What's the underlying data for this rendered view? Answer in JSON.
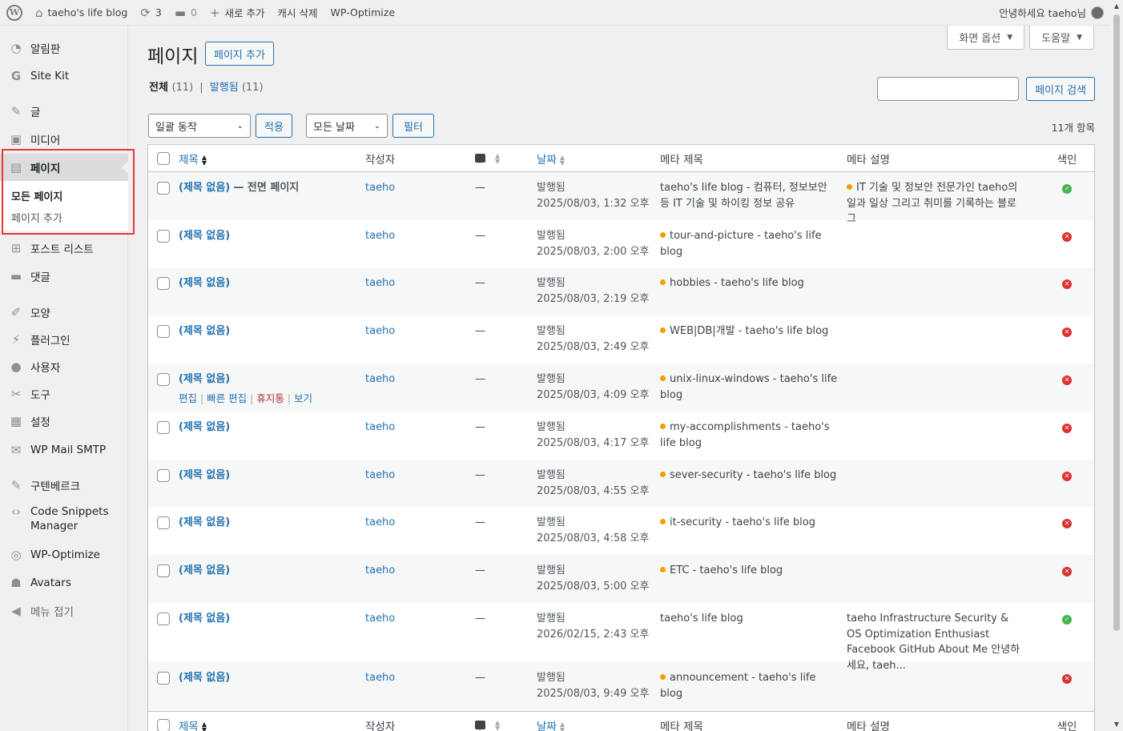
{
  "adminbar": {
    "site_name": "taeho's life blog",
    "updates_count": "3",
    "comments_count": "0",
    "new_label": "새로 추가",
    "cache_label": "캐시 삭제",
    "optimize_label": "WP-Optimize",
    "greeting": "안녕하세요 taeho님"
  },
  "sidebar": {
    "items": [
      {
        "label": "알림판",
        "icon": "dashboard-icon",
        "glyph": "◔"
      },
      {
        "label": "Site Kit",
        "icon": "google-icon",
        "glyph": "G"
      },
      {
        "label": "글",
        "icon": "pin-icon",
        "glyph": "✎"
      },
      {
        "label": "미디어",
        "icon": "media-icon",
        "glyph": "▣"
      },
      {
        "label": "페이지",
        "icon": "page-icon",
        "glyph": "▤"
      },
      {
        "label": "포스트 리스트",
        "icon": "grid-icon",
        "glyph": "⊞"
      },
      {
        "label": "댓글",
        "icon": "comment-icon",
        "glyph": "▬"
      },
      {
        "label": "모양",
        "icon": "brush-icon",
        "glyph": "✐"
      },
      {
        "label": "플러그인",
        "icon": "plugin-icon",
        "glyph": "⚡"
      },
      {
        "label": "사용자",
        "icon": "user-icon",
        "glyph": "●"
      },
      {
        "label": "도구",
        "icon": "wrench-icon",
        "glyph": "✂"
      },
      {
        "label": "설정",
        "icon": "settings-icon",
        "glyph": "▦"
      },
      {
        "label": "WP Mail SMTP",
        "icon": "mail-icon",
        "glyph": "✉"
      },
      {
        "label": "구텐베르크",
        "icon": "gutenberg-icon",
        "glyph": "✎"
      },
      {
        "label": "Code Snippets",
        "label2": "Manager",
        "icon": "code-icon",
        "glyph": "‹›"
      },
      {
        "label": "WP-Optimize",
        "icon": "optimize-icon",
        "glyph": "◎"
      },
      {
        "label": "Avatars",
        "icon": "avatars-icon",
        "glyph": "☗"
      },
      {
        "label": "메뉴 접기",
        "icon": "collapse-icon",
        "glyph": "◀"
      }
    ],
    "submenu": {
      "all_pages": "모든 페이지",
      "add_page": "페이지 추가"
    }
  },
  "header": {
    "title": "페이지",
    "add_new": "페이지 추가",
    "screen_options": "화면 옵션",
    "help": "도움말"
  },
  "views": {
    "all_label": "전체",
    "all_count": "(11)",
    "separator": "|",
    "published_label": "발행됨",
    "published_count": "(11)"
  },
  "search": {
    "button": "페이지 검색"
  },
  "tablenav": {
    "bulk_action": "일괄 동작",
    "apply": "적용",
    "all_dates": "모든 날짜",
    "filter": "필터",
    "item_count": "11개 항목"
  },
  "columns": {
    "title": "제목",
    "author": "작성자",
    "date": "날짜",
    "meta_title": "메타 제목",
    "meta_desc": "메타 설명",
    "index": "색인"
  },
  "rows": [
    {
      "title": "(제목 없음)",
      "state": "— 전면 페이지",
      "author": "taeho",
      "comments": "—",
      "status": "발행됨",
      "date": "2025/08/03, 1:32 오후",
      "meta_title": "taeho's life blog - 컴퓨터, 정보보안 등 IT 기술 및 하이킹 정보 공유",
      "meta_title_dot": false,
      "meta_desc": "IT 기술 및 정보안 전문가인 taeho의 일과 일상 그리고 취미를 기록하는 블로그",
      "meta_desc_dot": true,
      "indexed": "ok"
    },
    {
      "title": "(제목 없음)",
      "state": "",
      "author": "taeho",
      "comments": "—",
      "status": "발행됨",
      "date": "2025/08/03, 2:00 오후",
      "meta_title": "tour-and-picture - taeho's life blog",
      "meta_title_dot": true,
      "meta_desc": "",
      "meta_desc_dot": false,
      "indexed": "no"
    },
    {
      "title": "(제목 없음)",
      "state": "",
      "author": "taeho",
      "comments": "—",
      "status": "발행됨",
      "date": "2025/08/03, 2:19 오후",
      "meta_title": "hobbies - taeho's life blog",
      "meta_title_dot": true,
      "meta_desc": "",
      "meta_desc_dot": false,
      "indexed": "no"
    },
    {
      "title": "(제목 없음)",
      "state": "",
      "author": "taeho",
      "comments": "—",
      "status": "발행됨",
      "date": "2025/08/03, 2:49 오후",
      "meta_title": "WEB|DB|개발 - taeho's life blog",
      "meta_title_dot": true,
      "meta_desc": "",
      "meta_desc_dot": false,
      "indexed": "no"
    },
    {
      "title": "(제목 없음)",
      "state": "",
      "author": "taeho",
      "comments": "—",
      "status": "발행됨",
      "date": "2025/08/03, 4:09 오후",
      "meta_title": "unix-linux-windows - taeho's life blog",
      "meta_title_dot": true,
      "meta_desc": "",
      "meta_desc_dot": false,
      "indexed": "no",
      "actions": {
        "edit": "편집",
        "quick_edit": "빠른 편집",
        "trash": "휴지통",
        "view": "보기"
      }
    },
    {
      "title": "(제목 없음)",
      "state": "",
      "author": "taeho",
      "comments": "—",
      "status": "발행됨",
      "date": "2025/08/03, 4:17 오후",
      "meta_title": "my-accomplishments - taeho's life blog",
      "meta_title_dot": true,
      "meta_desc": "",
      "meta_desc_dot": false,
      "indexed": "no"
    },
    {
      "title": "(제목 없음)",
      "state": "",
      "author": "taeho",
      "comments": "—",
      "status": "발행됨",
      "date": "2025/08/03, 4:55 오후",
      "meta_title": "sever-security - taeho's life blog",
      "meta_title_dot": true,
      "meta_desc": "",
      "meta_desc_dot": false,
      "indexed": "no"
    },
    {
      "title": "(제목 없음)",
      "state": "",
      "author": "taeho",
      "comments": "—",
      "status": "발행됨",
      "date": "2025/08/03, 4:58 오후",
      "meta_title": "it-security - taeho's life blog",
      "meta_title_dot": true,
      "meta_desc": "",
      "meta_desc_dot": false,
      "indexed": "no"
    },
    {
      "title": "(제목 없음)",
      "state": "",
      "author": "taeho",
      "comments": "—",
      "status": "발행됨",
      "date": "2025/08/03, 5:00 오후",
      "meta_title": "ETC - taeho's life blog",
      "meta_title_dot": true,
      "meta_desc": "",
      "meta_desc_dot": false,
      "indexed": "no"
    },
    {
      "title": "(제목 없음)",
      "state": "",
      "author": "taeho",
      "comments": "—",
      "status": "발행됨",
      "date": "2026/02/15, 2:43 오후",
      "meta_title": "taeho's life blog",
      "meta_title_dot": false,
      "meta_desc": "taeho Infrastructure Security & OS Optimization Enthusiast Facebook GitHub About Me 안녕하세요, taeh...",
      "meta_desc_dot": false,
      "indexed": "ok"
    },
    {
      "title": "(제목 없음)",
      "state": "",
      "author": "taeho",
      "comments": "—",
      "status": "발행됨",
      "date": "2025/08/03, 9:49 오후",
      "meta_title": "announcement - taeho's life blog",
      "meta_title_dot": true,
      "meta_desc": "",
      "meta_desc_dot": false,
      "indexed": "no"
    }
  ],
  "colors": {
    "accent": "#2271b1",
    "warn_dot": "#f0a000",
    "ok": "#46b450",
    "error": "#dc3232",
    "highlight": "#e53935"
  }
}
